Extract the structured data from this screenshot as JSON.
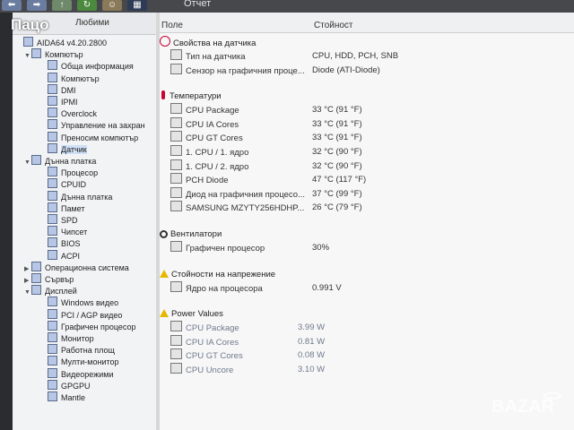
{
  "overlay": {
    "title": "Пацо"
  },
  "toolbar": {
    "report_label": "Отчет"
  },
  "left": {
    "header": "Любими",
    "items": [
      {
        "label": "AIDA64 v4.20.2800",
        "indent": 0,
        "expander": ""
      },
      {
        "label": "Компютър",
        "indent": 1,
        "expander": "▼"
      },
      {
        "label": "Обща информация",
        "indent": 3,
        "expander": ""
      },
      {
        "label": "Компютър",
        "indent": 3,
        "expander": ""
      },
      {
        "label": "DMI",
        "indent": 3,
        "expander": ""
      },
      {
        "label": "IPMI",
        "indent": 3,
        "expander": ""
      },
      {
        "label": "Overclock",
        "indent": 3,
        "expander": ""
      },
      {
        "label": "Управление на захран",
        "indent": 3,
        "expander": ""
      },
      {
        "label": "Преносим компютър",
        "indent": 3,
        "expander": ""
      },
      {
        "label": "Датчик",
        "indent": 3,
        "expander": "",
        "selected": true
      },
      {
        "label": "Дънна платка",
        "indent": 1,
        "expander": "▼"
      },
      {
        "label": "Процесор",
        "indent": 3,
        "expander": ""
      },
      {
        "label": "CPUID",
        "indent": 3,
        "expander": ""
      },
      {
        "label": "Дънна платка",
        "indent": 3,
        "expander": ""
      },
      {
        "label": "Памет",
        "indent": 3,
        "expander": ""
      },
      {
        "label": "SPD",
        "indent": 3,
        "expander": ""
      },
      {
        "label": "Чипсет",
        "indent": 3,
        "expander": ""
      },
      {
        "label": "BIOS",
        "indent": 3,
        "expander": ""
      },
      {
        "label": "ACPI",
        "indent": 3,
        "expander": ""
      },
      {
        "label": "Операционна система",
        "indent": 1,
        "expander": "▶"
      },
      {
        "label": "Сървър",
        "indent": 1,
        "expander": "▶"
      },
      {
        "label": "Дисплей",
        "indent": 1,
        "expander": "▼"
      },
      {
        "label": "Windows видео",
        "indent": 3,
        "expander": ""
      },
      {
        "label": "PCI / AGP видео",
        "indent": 3,
        "expander": ""
      },
      {
        "label": "Графичен процесор",
        "indent": 3,
        "expander": ""
      },
      {
        "label": "Монитор",
        "indent": 3,
        "expander": ""
      },
      {
        "label": "Работна площ",
        "indent": 3,
        "expander": ""
      },
      {
        "label": "Мулти-монитор",
        "indent": 3,
        "expander": ""
      },
      {
        "label": "Видеорежими",
        "indent": 3,
        "expander": ""
      },
      {
        "label": "GPGPU",
        "indent": 3,
        "expander": ""
      },
      {
        "label": "Mantle",
        "indent": 3,
        "expander": ""
      }
    ]
  },
  "right": {
    "col_field": "Поле",
    "col_value": "Стойност",
    "sections": [
      {
        "title": "Свойства на датчика",
        "icon": "sensor",
        "rows": [
          {
            "field": "Тип на датчика",
            "value": "CPU, HDD, PCH, SNB"
          },
          {
            "field": "Сензор на графичния проце...",
            "value": "Diode  (ATI-Diode)"
          }
        ]
      },
      {
        "title": "Температури",
        "icon": "temp",
        "rows": [
          {
            "field": "CPU Package",
            "value": "33 °C  (91 °F)"
          },
          {
            "field": "CPU IA Cores",
            "value": "33 °C  (91 °F)"
          },
          {
            "field": "CPU GT Cores",
            "value": "33 °C  (91 °F)"
          },
          {
            "field": "1. CPU / 1. ядро",
            "value": "32 °C  (90 °F)"
          },
          {
            "field": "1. CPU / 2. ядро",
            "value": "32 °C  (90 °F)"
          },
          {
            "field": "PCH Diode",
            "value": "47 °C  (117 °F)"
          },
          {
            "field": "Диод на графичния процесо...",
            "value": "37 °C  (99 °F)"
          },
          {
            "field": "SAMSUNG MZYTY256HDHP...",
            "value": "26 °C  (79 °F)"
          }
        ]
      },
      {
        "title": "Вентилатори",
        "icon": "fan",
        "rows": [
          {
            "field": "Графичен процесор",
            "value": "30%"
          }
        ]
      },
      {
        "title": "Стойности на напрежение",
        "icon": "warn",
        "rows": [
          {
            "field": "Ядро на процесора",
            "value": "0.991 V"
          }
        ]
      },
      {
        "title": "Power Values",
        "icon": "warn",
        "rows": [
          {
            "field": "CPU Package",
            "value": "3.99 W"
          },
          {
            "field": "CPU IA Cores",
            "value": "0.81 W"
          },
          {
            "field": "CPU GT Cores",
            "value": "0.08 W"
          },
          {
            "field": "CPU Uncore",
            "value": "3.10 W"
          }
        ]
      }
    ]
  },
  "watermark": {
    "text": "BAZAR"
  }
}
